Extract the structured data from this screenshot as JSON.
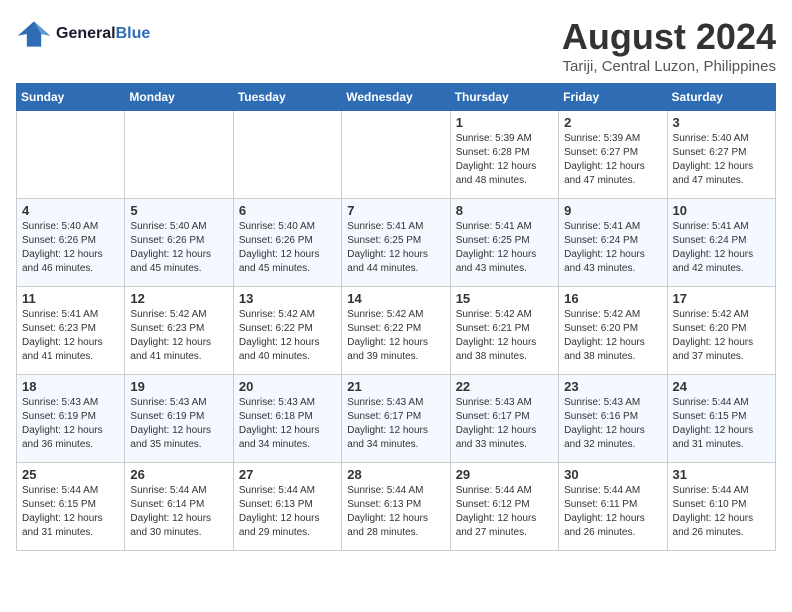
{
  "header": {
    "logo_line1": "General",
    "logo_line2": "Blue",
    "month": "August 2024",
    "location": "Tariji, Central Luzon, Philippines"
  },
  "weekdays": [
    "Sunday",
    "Monday",
    "Tuesday",
    "Wednesday",
    "Thursday",
    "Friday",
    "Saturday"
  ],
  "weeks": [
    [
      {
        "day": "",
        "empty": true
      },
      {
        "day": "",
        "empty": true
      },
      {
        "day": "",
        "empty": true
      },
      {
        "day": "",
        "empty": true
      },
      {
        "day": "1",
        "sunrise": "5:39 AM",
        "sunset": "6:28 PM",
        "daylight": "12 hours and 48 minutes."
      },
      {
        "day": "2",
        "sunrise": "5:39 AM",
        "sunset": "6:27 PM",
        "daylight": "12 hours and 47 minutes."
      },
      {
        "day": "3",
        "sunrise": "5:40 AM",
        "sunset": "6:27 PM",
        "daylight": "12 hours and 47 minutes."
      }
    ],
    [
      {
        "day": "4",
        "sunrise": "5:40 AM",
        "sunset": "6:26 PM",
        "daylight": "12 hours and 46 minutes."
      },
      {
        "day": "5",
        "sunrise": "5:40 AM",
        "sunset": "6:26 PM",
        "daylight": "12 hours and 45 minutes."
      },
      {
        "day": "6",
        "sunrise": "5:40 AM",
        "sunset": "6:26 PM",
        "daylight": "12 hours and 45 minutes."
      },
      {
        "day": "7",
        "sunrise": "5:41 AM",
        "sunset": "6:25 PM",
        "daylight": "12 hours and 44 minutes."
      },
      {
        "day": "8",
        "sunrise": "5:41 AM",
        "sunset": "6:25 PM",
        "daylight": "12 hours and 43 minutes."
      },
      {
        "day": "9",
        "sunrise": "5:41 AM",
        "sunset": "6:24 PM",
        "daylight": "12 hours and 43 minutes."
      },
      {
        "day": "10",
        "sunrise": "5:41 AM",
        "sunset": "6:24 PM",
        "daylight": "12 hours and 42 minutes."
      }
    ],
    [
      {
        "day": "11",
        "sunrise": "5:41 AM",
        "sunset": "6:23 PM",
        "daylight": "12 hours and 41 minutes."
      },
      {
        "day": "12",
        "sunrise": "5:42 AM",
        "sunset": "6:23 PM",
        "daylight": "12 hours and 41 minutes."
      },
      {
        "day": "13",
        "sunrise": "5:42 AM",
        "sunset": "6:22 PM",
        "daylight": "12 hours and 40 minutes."
      },
      {
        "day": "14",
        "sunrise": "5:42 AM",
        "sunset": "6:22 PM",
        "daylight": "12 hours and 39 minutes."
      },
      {
        "day": "15",
        "sunrise": "5:42 AM",
        "sunset": "6:21 PM",
        "daylight": "12 hours and 38 minutes."
      },
      {
        "day": "16",
        "sunrise": "5:42 AM",
        "sunset": "6:20 PM",
        "daylight": "12 hours and 38 minutes."
      },
      {
        "day": "17",
        "sunrise": "5:42 AM",
        "sunset": "6:20 PM",
        "daylight": "12 hours and 37 minutes."
      }
    ],
    [
      {
        "day": "18",
        "sunrise": "5:43 AM",
        "sunset": "6:19 PM",
        "daylight": "12 hours and 36 minutes."
      },
      {
        "day": "19",
        "sunrise": "5:43 AM",
        "sunset": "6:19 PM",
        "daylight": "12 hours and 35 minutes."
      },
      {
        "day": "20",
        "sunrise": "5:43 AM",
        "sunset": "6:18 PM",
        "daylight": "12 hours and 34 minutes."
      },
      {
        "day": "21",
        "sunrise": "5:43 AM",
        "sunset": "6:17 PM",
        "daylight": "12 hours and 34 minutes."
      },
      {
        "day": "22",
        "sunrise": "5:43 AM",
        "sunset": "6:17 PM",
        "daylight": "12 hours and 33 minutes."
      },
      {
        "day": "23",
        "sunrise": "5:43 AM",
        "sunset": "6:16 PM",
        "daylight": "12 hours and 32 minutes."
      },
      {
        "day": "24",
        "sunrise": "5:44 AM",
        "sunset": "6:15 PM",
        "daylight": "12 hours and 31 minutes."
      }
    ],
    [
      {
        "day": "25",
        "sunrise": "5:44 AM",
        "sunset": "6:15 PM",
        "daylight": "12 hours and 31 minutes."
      },
      {
        "day": "26",
        "sunrise": "5:44 AM",
        "sunset": "6:14 PM",
        "daylight": "12 hours and 30 minutes."
      },
      {
        "day": "27",
        "sunrise": "5:44 AM",
        "sunset": "6:13 PM",
        "daylight": "12 hours and 29 minutes."
      },
      {
        "day": "28",
        "sunrise": "5:44 AM",
        "sunset": "6:13 PM",
        "daylight": "12 hours and 28 minutes."
      },
      {
        "day": "29",
        "sunrise": "5:44 AM",
        "sunset": "6:12 PM",
        "daylight": "12 hours and 27 minutes."
      },
      {
        "day": "30",
        "sunrise": "5:44 AM",
        "sunset": "6:11 PM",
        "daylight": "12 hours and 26 minutes."
      },
      {
        "day": "31",
        "sunrise": "5:44 AM",
        "sunset": "6:10 PM",
        "daylight": "12 hours and 26 minutes."
      }
    ]
  ]
}
